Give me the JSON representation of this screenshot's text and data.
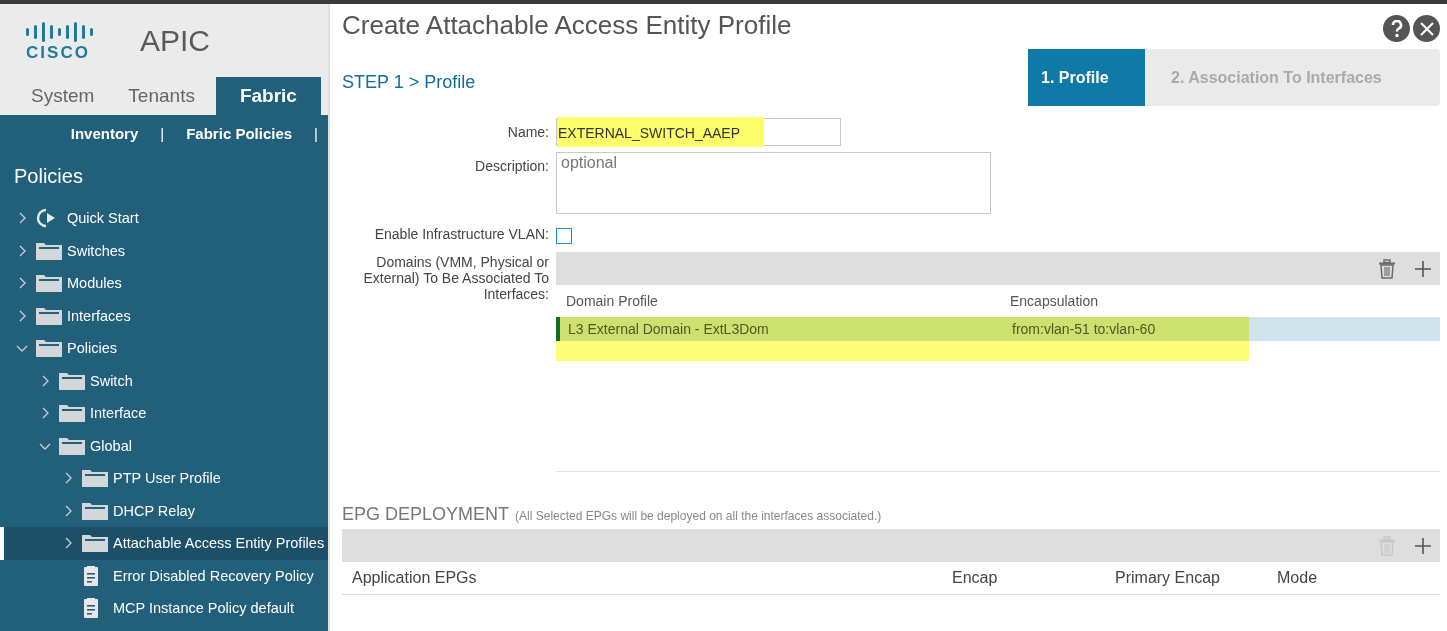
{
  "brand": {
    "logo_text": "CISCO",
    "product": "APIC"
  },
  "tabs": [
    {
      "label": "System",
      "selected": false
    },
    {
      "label": "Tenants",
      "selected": false
    },
    {
      "label": "Fabric",
      "selected": true
    }
  ],
  "subnav": [
    "Inventory",
    "|",
    "Fabric Policies",
    "|"
  ],
  "sidebar": {
    "title": "Policies",
    "items": [
      {
        "label": "Quick Start",
        "kind": "quick-start",
        "expanded": false,
        "selected": false
      },
      {
        "label": "Switches",
        "kind": "folder",
        "expanded": false,
        "selected": false
      },
      {
        "label": "Modules",
        "kind": "folder",
        "expanded": false,
        "selected": false
      },
      {
        "label": "Interfaces",
        "kind": "folder",
        "expanded": false,
        "selected": false
      },
      {
        "label": "Policies",
        "kind": "folder",
        "expanded": true,
        "selected": false,
        "children": [
          {
            "label": "Switch",
            "kind": "folder",
            "expanded": false,
            "selected": false
          },
          {
            "label": "Interface",
            "kind": "folder",
            "expanded": false,
            "selected": false
          },
          {
            "label": "Global",
            "kind": "folder",
            "expanded": true,
            "selected": false,
            "children": [
              {
                "label": "PTP User Profile",
                "kind": "folder",
                "expanded": false,
                "selected": false
              },
              {
                "label": "DHCP Relay",
                "kind": "folder",
                "expanded": false,
                "selected": false
              },
              {
                "label": "Attachable Access Entity Profiles",
                "kind": "folder",
                "expanded": false,
                "selected": true
              },
              {
                "label": "Error Disabled Recovery Policy",
                "kind": "policy",
                "selected": false
              },
              {
                "label": "MCP Instance Policy default",
                "kind": "policy",
                "selected": false
              }
            ]
          }
        ]
      }
    ]
  },
  "dialog": {
    "title": "Create Attachable Access Entity Profile",
    "step_heading": "STEP 1 > Profile",
    "steps": [
      {
        "label": "1. Profile",
        "selected": true
      },
      {
        "label": "2. Association To Interfaces",
        "selected": false
      }
    ],
    "form": {
      "name_label": "Name:",
      "name_value": "EXTERNAL_SWITCH_AAEP",
      "name_highlighted": true,
      "description_label": "Description:",
      "description_placeholder": "optional",
      "infra_vlan_label": "Enable Infrastructure VLAN:",
      "infra_vlan_checked": false,
      "domains_label": "Domains (VMM, Physical or External) To Be Associated To Interfaces:"
    },
    "domains_table": {
      "columns": [
        "Domain Profile",
        "Encapsulation"
      ],
      "rows": [
        {
          "cells": [
            "L3 External Domain - ExtL3Dom",
            "from:vlan-51 to:vlan-60"
          ],
          "selected": true,
          "highlighted": true
        }
      ],
      "delete_disabled": false
    },
    "epg": {
      "title": "EPG DEPLOYMENT",
      "note": "(All Selected EPGs will be deployed on all the interfaces associated.)",
      "columns": [
        "Application EPGs",
        "Encap",
        "Primary Encap",
        "Mode"
      ],
      "delete_disabled": true
    }
  }
}
